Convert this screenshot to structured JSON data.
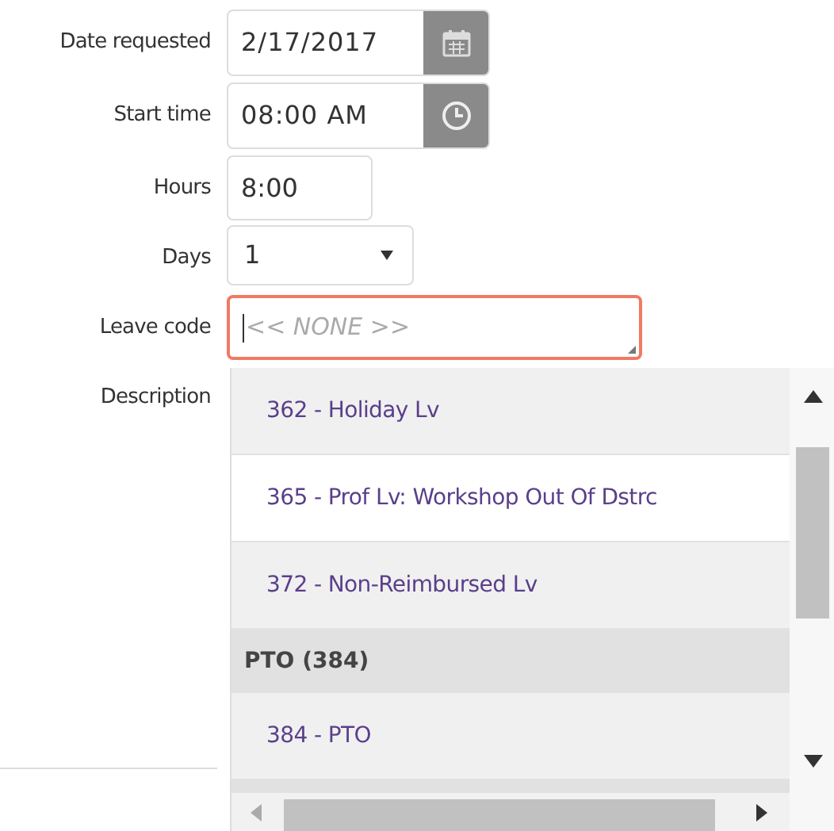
{
  "form": {
    "fields": [
      {
        "label": "Date requested",
        "kind": "date",
        "value": "2/17/2017"
      },
      {
        "label": "Start time",
        "kind": "time",
        "value": "08:00 AM"
      },
      {
        "label": "Hours",
        "kind": "text",
        "value": "8:00"
      },
      {
        "label": "Days",
        "kind": "select",
        "value": "1"
      },
      {
        "label": "Leave code",
        "kind": "combo",
        "placeholder": "<< NONE >>",
        "focused": true
      },
      {
        "label": "Description",
        "kind": "label"
      }
    ]
  },
  "dropdown": {
    "items": [
      {
        "kind": "option",
        "label": "362 - Holiday Lv",
        "highlighted": false
      },
      {
        "kind": "option",
        "label": "365 - Prof Lv: Workshop Out Of Dstrc",
        "highlighted": true
      },
      {
        "kind": "option",
        "label": "372 - Non-Reimbursed Lv",
        "highlighted": false
      },
      {
        "kind": "group",
        "label": "PTO (384)"
      },
      {
        "kind": "option",
        "label": "384 - PTO",
        "highlighted": false
      },
      {
        "kind": "group"
      }
    ]
  }
}
